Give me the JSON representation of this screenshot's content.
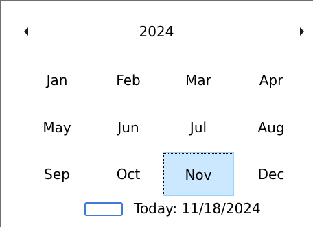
{
  "header": {
    "title": "2024",
    "prev_arrow_icon": "triangle-left-icon",
    "next_arrow_icon": "triangle-right-icon"
  },
  "months": [
    {
      "label": "Jan"
    },
    {
      "label": "Feb"
    },
    {
      "label": "Mar"
    },
    {
      "label": "Apr"
    },
    {
      "label": "May"
    },
    {
      "label": "Jun"
    },
    {
      "label": "Jul"
    },
    {
      "label": "Aug"
    },
    {
      "label": "Sep"
    },
    {
      "label": "Oct"
    },
    {
      "label": "Nov"
    },
    {
      "label": "Dec"
    }
  ],
  "selected_month": "Nov",
  "today": {
    "label": "Today: 11/18/2024"
  },
  "colors": {
    "selection_fill": "#cce8ff",
    "selection_border": "#99d1ff",
    "today_box_border": "#3d7bd6",
    "control_border": "#6e6e6e"
  }
}
